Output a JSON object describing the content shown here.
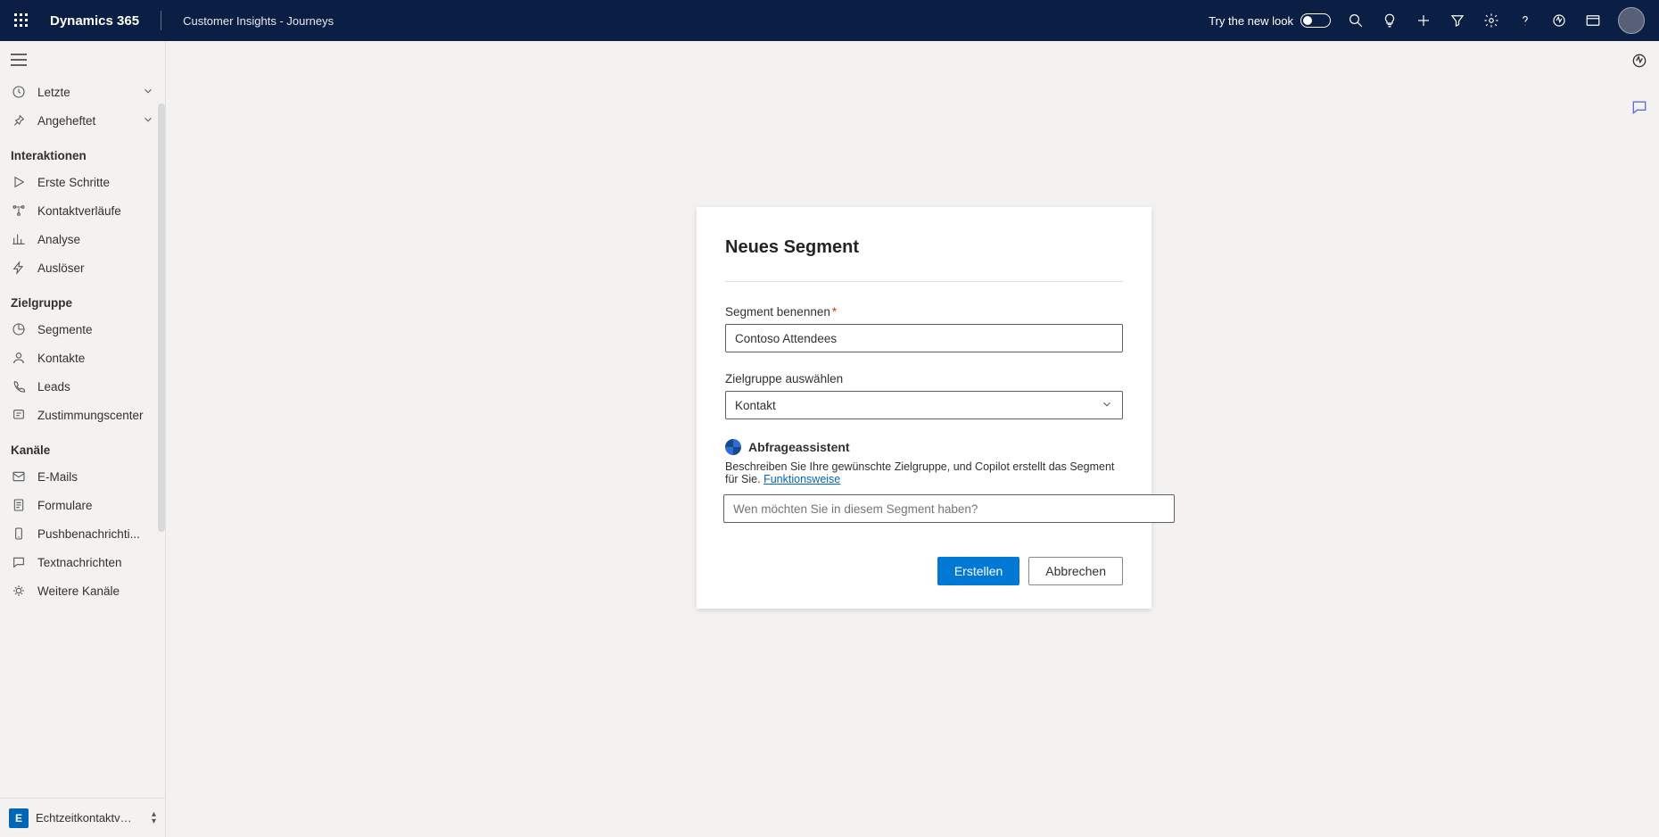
{
  "topbar": {
    "brand": "Dynamics 365",
    "app": "Customer Insights - Journeys",
    "try_label": "Try the new look"
  },
  "sidebar": {
    "recent": "Letzte",
    "pinned": "Angeheftet",
    "sections": {
      "interactions": "Interaktionen",
      "audience": "Zielgruppe",
      "channels": "Kanäle"
    },
    "items": {
      "get_started": "Erste Schritte",
      "journeys": "Kontaktverläufe",
      "analytics": "Analyse",
      "triggers": "Auslöser",
      "segments": "Segmente",
      "contacts": "Kontakte",
      "leads": "Leads",
      "consent": "Zustimmungscenter",
      "emails": "E-Mails",
      "forms": "Formulare",
      "push": "Pushbenachrichti...",
      "texts": "Textnachrichten",
      "more_channels": "Weitere Kanäle"
    },
    "area": {
      "initial": "E",
      "name": "Echtzeitkontaktve..."
    }
  },
  "dialog": {
    "title": "Neues Segment",
    "name_label": "Segment benennen",
    "name_value": "Contoso Attendees",
    "audience_label": "Zielgruppe auswählen",
    "audience_value": "Kontakt",
    "qa_title": "Abfrageassistent",
    "qa_desc": "Beschreiben Sie Ihre gewünschte Zielgruppe, und Copilot erstellt das Segment für Sie.",
    "qa_link": "Funktionsweise",
    "qa_placeholder": "Wen möchten Sie in diesem Segment haben?",
    "create": "Erstellen",
    "cancel": "Abbrechen"
  }
}
